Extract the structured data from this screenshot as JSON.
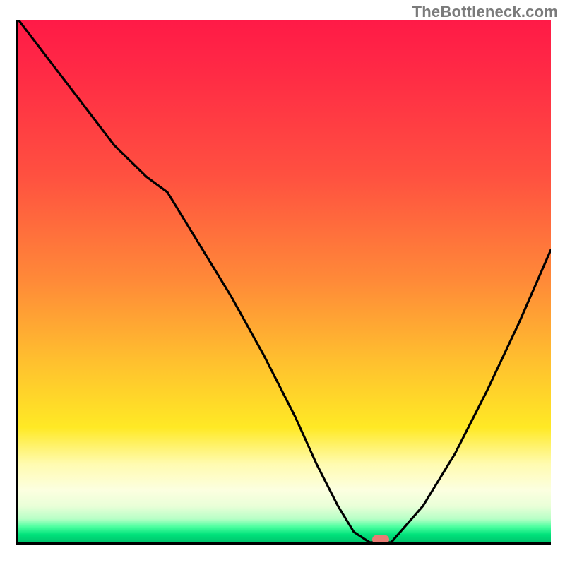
{
  "watermark": "TheBottleneck.com",
  "chart_data": {
    "type": "line",
    "title": "",
    "xlabel": "",
    "ylabel": "",
    "xlim": [
      0,
      100
    ],
    "ylim": [
      0,
      100
    ],
    "grid": false,
    "legend": false,
    "series": [
      {
        "name": "bottleneck-curve",
        "x": [
          0,
          6,
          12,
          18,
          24,
          28,
          34,
          40,
          46,
          52,
          56,
          60,
          63,
          66,
          70,
          76,
          82,
          88,
          94,
          100
        ],
        "y": [
          100,
          92,
          84,
          76,
          70,
          67,
          57,
          47,
          36,
          24,
          15,
          7,
          2,
          0,
          0,
          7,
          17,
          29,
          42,
          56
        ]
      }
    ],
    "marker": {
      "x": 68,
      "y": 0,
      "color": "#e97b74"
    },
    "background_gradient": {
      "direction": "vertical",
      "stops": [
        {
          "pos": 0.0,
          "color": "#ff1a47"
        },
        {
          "pos": 0.5,
          "color": "#ff8a38"
        },
        {
          "pos": 0.78,
          "color": "#ffe925"
        },
        {
          "pos": 0.9,
          "color": "#fcffe0"
        },
        {
          "pos": 0.97,
          "color": "#4dffa0"
        },
        {
          "pos": 1.0,
          "color": "#00c46d"
        }
      ]
    }
  }
}
